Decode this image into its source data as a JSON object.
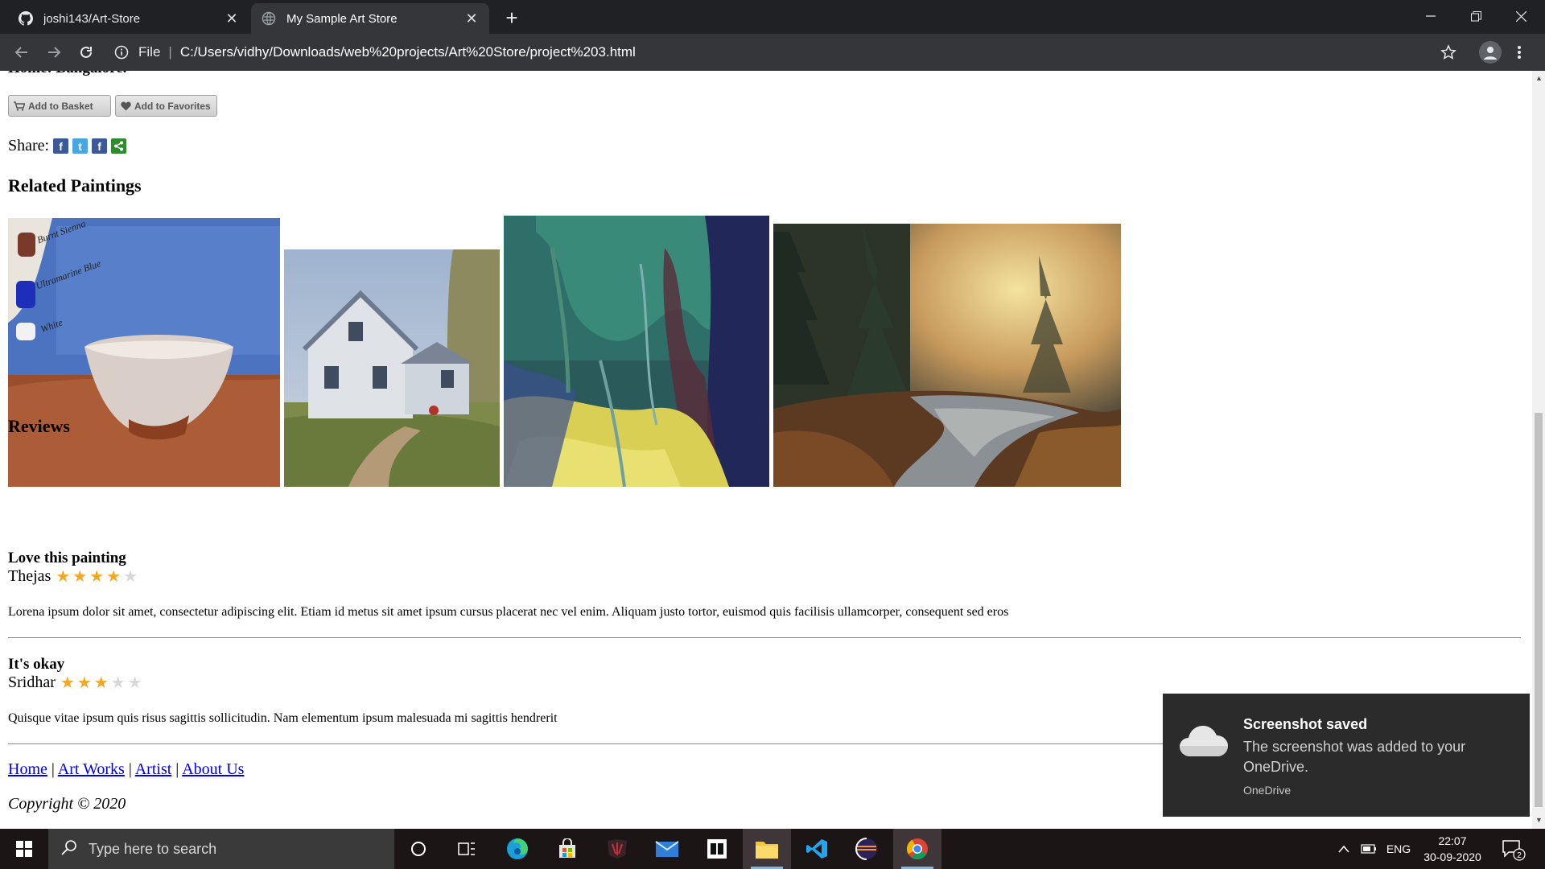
{
  "browser": {
    "tabs": [
      {
        "title": "joshi143/Art-Store",
        "icon": "github-icon",
        "active": false
      },
      {
        "title": "My Sample Art Store",
        "icon": "globe-icon",
        "active": true
      }
    ],
    "address": {
      "scheme_label": "File",
      "url": "C:/Users/vidhy/Downloads/web%20projects/Art%20Store/project%203.html"
    }
  },
  "page": {
    "cut_off_text": "Home: Bangalore.",
    "buttons": {
      "add_to_basket": "Add to Basket",
      "add_to_favorites": "Add to Favorites"
    },
    "share_label": "Share:",
    "related_heading": "Related Paintings",
    "reviews_heading": "Reviews",
    "reviews": [
      {
        "title": "Love this painting",
        "author": "Thejas",
        "rating": 4,
        "max": 5,
        "text": "Lorena ipsum dolor sit amet, consectetur adipiscing elit. Etiam id metus sit amet ipsum cursus placerat nec vel enim. Aliquam justo tortor, euismod quis facilisis ullamcorper, consequent sed eros"
      },
      {
        "title": "It's okay",
        "author": "Sridhar",
        "rating": 3,
        "max": 5,
        "text": "Quisque vitae ipsum quis risus sagittis sollicitudin. Nam elementum ipsum malesuada mi sagittis hendrerit"
      }
    ],
    "footer": {
      "links": [
        "Home",
        "Art Works",
        "Artist",
        "About Us"
      ],
      "copyright": "Copyright © 2020"
    },
    "painting_labels": [
      "Burnt Sienna",
      "Ultramarine Blue",
      "White"
    ]
  },
  "toast": {
    "title": "Screenshot saved",
    "body": "The screenshot was added to your OneDrive.",
    "source": "OneDrive"
  },
  "taskbar": {
    "search_placeholder": "Type here to search",
    "language": "ENG",
    "time": "22:07",
    "date": "30-09-2020",
    "notification_count": "2"
  }
}
